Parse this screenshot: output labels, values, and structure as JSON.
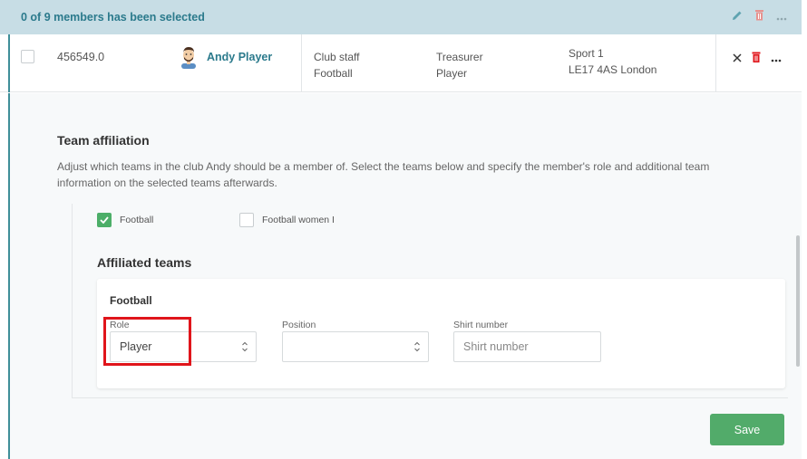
{
  "header": {
    "selection_text": "0 of 9 members has been selected",
    "icons": [
      "pencil-icon",
      "trash-icon",
      "more-icon"
    ]
  },
  "member": {
    "id": "456549.0",
    "name": "Andy Player",
    "role_type": "Club staff",
    "sport": "Football",
    "title1": "Treasurer",
    "title2": "Player",
    "address1": "Sport 1",
    "address2": "LE17 4AS London",
    "actions": [
      "close-icon",
      "trash-icon",
      "more-icon"
    ]
  },
  "affiliation": {
    "title": "Team affiliation",
    "description": "Adjust which teams in the club Andy should be a member of. Select the teams below and specify the member's role and additional team information on the selected teams afterwards.",
    "teams": [
      {
        "label": "Football",
        "checked": true
      },
      {
        "label": "Football women I",
        "checked": false
      }
    ],
    "affiliated_title": "Affiliated teams",
    "card": {
      "team_name": "Football",
      "role_label": "Role",
      "role_value": "Player",
      "position_label": "Position",
      "position_value": "",
      "shirt_label": "Shirt number",
      "shirt_placeholder": "Shirt number"
    }
  },
  "save_label": "Save",
  "colors": {
    "accent": "#2b7a8c",
    "header_bg": "#c7dde5",
    "save": "#52ab6a",
    "danger": "#e0151b"
  }
}
